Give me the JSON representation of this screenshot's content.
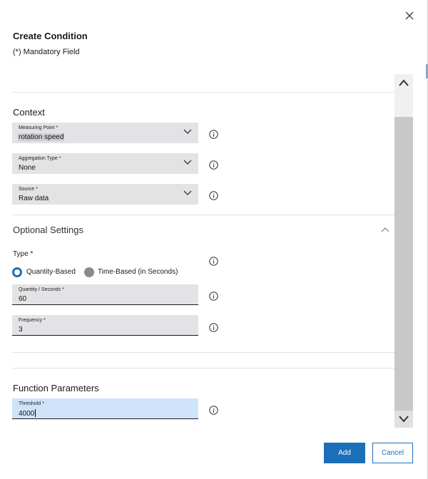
{
  "dialog": {
    "title": "Create Condition",
    "mandatory_note": "(*) Mandatory Field"
  },
  "context": {
    "heading": "Context",
    "measuring_point": {
      "label": "Measuring Point *",
      "value": "rotation speed"
    },
    "aggregation_type": {
      "label": "Aggregation Type *",
      "value": "None"
    },
    "source": {
      "label": "Source *",
      "value": "Raw data"
    }
  },
  "optional": {
    "heading": "Optional Settings",
    "type_label": "Type *",
    "options": [
      "Quantity-Based",
      "Time-Based (in Seconds)"
    ],
    "selected": "Quantity-Based",
    "quantity": {
      "label": "Quantity / Seconds *",
      "value": "60"
    },
    "frequency": {
      "label": "Frequency *",
      "value": "3"
    }
  },
  "function": {
    "heading": "Function Parameters",
    "threshold": {
      "label": "Threshold *",
      "value": "4000"
    }
  },
  "actions": {
    "add_label": "Add",
    "cancel_label": "Cancel"
  },
  "colors": {
    "primary": "#1a6fb8",
    "field_bg": "#e3e3e6",
    "active_field_bg": "#cfe4fb"
  }
}
